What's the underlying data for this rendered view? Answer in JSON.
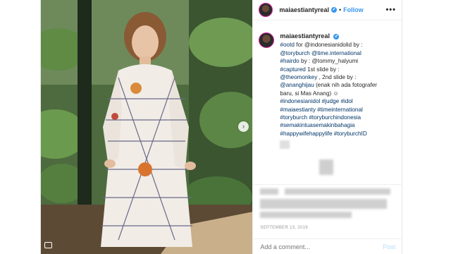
{
  "header": {
    "username": "maiaestiantyreal",
    "verified_glyph": "✔",
    "separator": "•",
    "follow_label": "Follow",
    "more_label": "•••"
  },
  "caption": {
    "username": "maiaestiantyreal",
    "lines": [
      {
        "hash": "#ootd",
        "rest": " for @indonesianidolid by :"
      },
      {
        "hash": "@toryburch @time.international",
        "rest": ""
      },
      {
        "hash": "#hairdo",
        "rest": " by : @tommy_halyumi"
      },
      {
        "hash": "#captured",
        "rest": " 1st slide by :"
      },
      {
        "hash": "@theomonkey",
        "rest": " , 2nd slide by :"
      },
      {
        "hash": "@ananghijau",
        "rest": " (enak nih ada fotografer"
      },
      {
        "hash": "",
        "rest": "baru, si Mas Anang) ☺"
      },
      {
        "hash": "#indonesianidol #judge #idol",
        "rest": ""
      },
      {
        "hash": "#maiaestianty #timeinternational",
        "rest": ""
      },
      {
        "hash": "#toryburch #toryburchindonesia",
        "rest": ""
      },
      {
        "hash": "#semakintuasemakinbahagia",
        "rest": ""
      },
      {
        "hash": "#happywifehappylife #toryburchID",
        "rest": ""
      }
    ]
  },
  "date": "SEPTEMBER 13, 2019",
  "comment": {
    "placeholder": "Add a comment...",
    "post_label": "Post"
  },
  "icons": {
    "next": "chevron-right-icon",
    "multi": "carousel-icon"
  },
  "colors": {
    "link": "#003569",
    "follow": "#3897f0",
    "post_disabled": "#b2dffc"
  }
}
